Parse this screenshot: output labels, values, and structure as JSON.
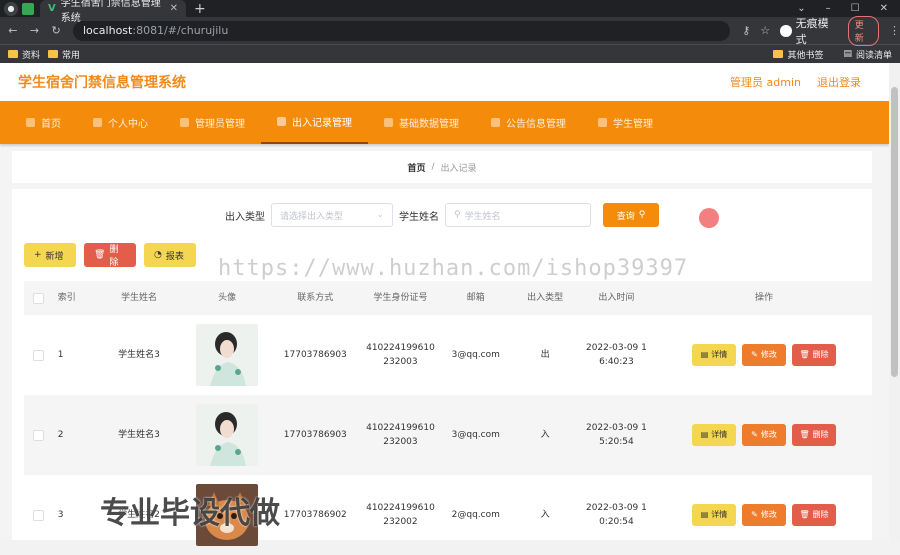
{
  "browser": {
    "tab_title": "学生宿舍门禁信息管理系统",
    "url_host": "localhost",
    "url_path": ":8081/#/churujilu",
    "incognito_label": "无痕模式",
    "update_label": "更新",
    "bookmarks": [
      "资料",
      "常用"
    ],
    "bookmarks_right": [
      "其他书签",
      "阅读清单"
    ]
  },
  "header": {
    "title": "学生宿舍门禁信息管理系统",
    "user_label": "管理员 admin",
    "logout_label": "退出登录"
  },
  "menu": [
    {
      "label": "首页",
      "icon": "home-icon"
    },
    {
      "label": "个人中心",
      "icon": "user-icon"
    },
    {
      "label": "管理员管理",
      "icon": "admin-icon"
    },
    {
      "label": "出入记录管理",
      "icon": "record-icon",
      "active": true
    },
    {
      "label": "基础数据管理",
      "icon": "data-icon"
    },
    {
      "label": "公告信息管理",
      "icon": "notice-icon"
    },
    {
      "label": "学生管理",
      "icon": "student-icon"
    }
  ],
  "breadcrumb": {
    "home": "首页",
    "sep": "/",
    "current": "出入记录"
  },
  "search": {
    "type_label": "出入类型",
    "type_placeholder": "请选择出入类型",
    "name_label": "学生姓名",
    "name_placeholder": "学生姓名",
    "query_label": "查询"
  },
  "actions": {
    "add": "新增",
    "delete": "删除",
    "report": "报表"
  },
  "table": {
    "headers": [
      "索引",
      "学生姓名",
      "头像",
      "联系方式",
      "学生身份证号",
      "邮箱",
      "出入类型",
      "出入时间",
      "操作"
    ],
    "rows": [
      {
        "index": "1",
        "name": "学生姓名3",
        "phone": "17703786903",
        "id1": "410224199610",
        "id2": "232003",
        "email": "3@qq.com",
        "type": "出",
        "time1": "2022-03-09 1",
        "time2": "6:40:23",
        "avatar": "woman"
      },
      {
        "index": "2",
        "name": "学生姓名3",
        "phone": "17703786903",
        "id1": "410224199610",
        "id2": "232003",
        "email": "3@qq.com",
        "type": "入",
        "time1": "2022-03-09 1",
        "time2": "5:20:54",
        "avatar": "woman"
      },
      {
        "index": "3",
        "name": "学生姓名2",
        "phone": "17703786902",
        "id1": "410224199610",
        "id2": "232002",
        "email": "2@qq.com",
        "type": "入",
        "time1": "2022-03-09 1",
        "time2": "0:20:54",
        "avatar": "dog"
      }
    ],
    "row_buttons": {
      "detail": "详情",
      "edit": "修改",
      "remove": "删除"
    }
  },
  "overlay": {
    "watermark": "https://www.huzhan.com/ishop39397",
    "promo": "专业毕设代做"
  },
  "colors": {
    "accent": "#f58b0a",
    "title": "#f18a1a",
    "yellow": "#f4d650",
    "red": "#e35d4b"
  }
}
